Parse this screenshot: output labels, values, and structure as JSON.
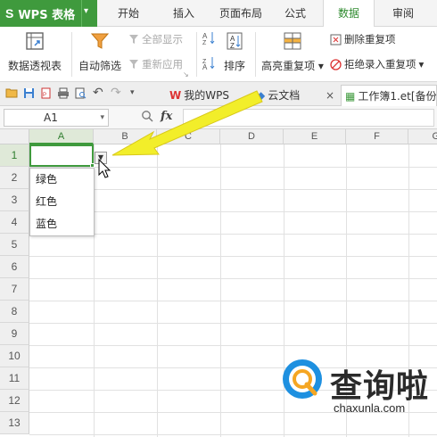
{
  "app": {
    "logo": "S",
    "title": "WPS 表格",
    "menu_arrow": "▾"
  },
  "menu_tabs": [
    {
      "label": "开始"
    },
    {
      "label": "插入"
    },
    {
      "label": "页面布局"
    },
    {
      "label": "公式"
    },
    {
      "label": "数据",
      "active": true
    },
    {
      "label": "审阅"
    }
  ],
  "ribbon": {
    "pivot_label": "数据透视表",
    "autofilter_label": "自动筛选",
    "show_all_label": "全部显示",
    "reapply_label": "重新应用",
    "sort_label": "排序",
    "highlight_dup_label": "高亮重复项",
    "delete_dup_label": "删除重复项",
    "reject_dup_label": "拒绝录入重复项"
  },
  "doc_tabs": [
    {
      "label": "我的WPS"
    },
    {
      "label": "云文档"
    },
    {
      "label": "工作簿1.et[备份]",
      "active": true
    }
  ],
  "formula_bar": {
    "cell_ref": "A1",
    "fx_label": "fx",
    "value": ""
  },
  "columns": [
    "A",
    "B",
    "C",
    "D",
    "E",
    "F",
    "G"
  ],
  "rows": [
    "1",
    "2",
    "3",
    "4",
    "5",
    "6",
    "7",
    "8",
    "9",
    "10",
    "11",
    "12",
    "13"
  ],
  "dropdown": {
    "options": [
      "绿色",
      "红色",
      "蓝色"
    ]
  },
  "watermark": {
    "brand_cn": "查询啦",
    "brand_en": "chaxunla.com"
  },
  "colors": {
    "accent": "#3f9a3d",
    "arrow": "#f2ee2a"
  }
}
